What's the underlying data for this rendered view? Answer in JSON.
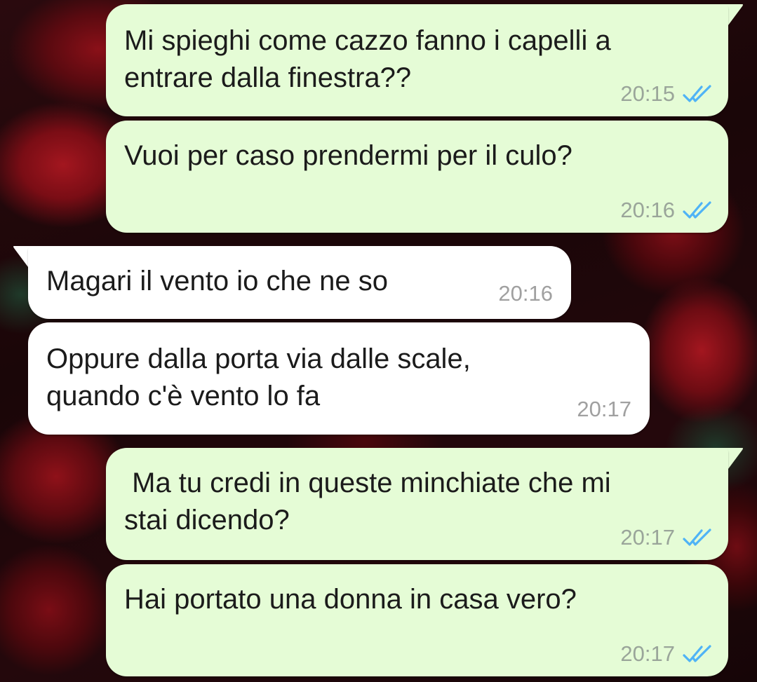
{
  "chat": {
    "messages": [
      {
        "direction": "outgoing",
        "text": "Mi spieghi come cazzo fanno i capelli a\nentrare dalla finestra??",
        "time": "20:15",
        "status": "read-ticks-icon"
      },
      {
        "direction": "outgoing",
        "text": "Vuoi per caso prendermi per il culo?",
        "time": "20:16",
        "status": "read-ticks-icon"
      },
      {
        "direction": "incoming",
        "text": "Magari il vento io che ne so",
        "time": "20:16"
      },
      {
        "direction": "incoming",
        "text": "Oppure dalla porta via dalle scale,\nquando c'è vento lo fa",
        "time": "20:17"
      },
      {
        "direction": "outgoing",
        "text": " Ma tu credi in queste minchiate che mi\nstai dicendo?",
        "time": "20:17",
        "status": "read-ticks-icon"
      },
      {
        "direction": "outgoing",
        "text": "Hai portato una donna in casa vero?",
        "time": "20:17",
        "status": "read-ticks-icon"
      }
    ]
  },
  "colors": {
    "outgoing_bubble": "#e5fcd6",
    "incoming_bubble": "#ffffff",
    "read_ticks": "#4fb3f6",
    "timestamp": "#9aa59a"
  }
}
